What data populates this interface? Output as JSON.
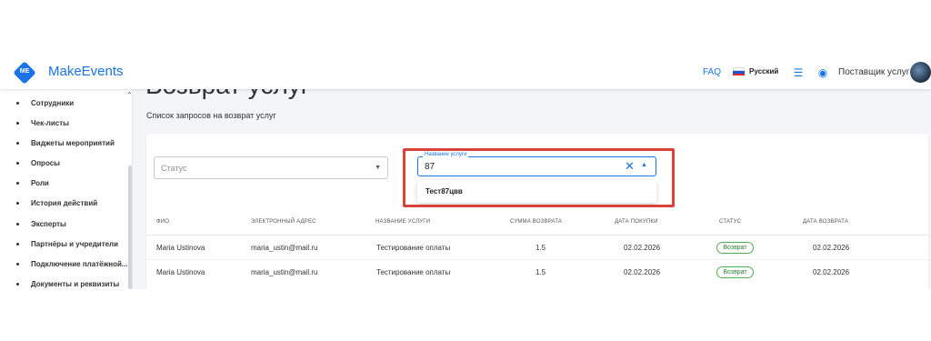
{
  "app": {
    "logo_text": "ME",
    "brand": "MakeEvents"
  },
  "topbar": {
    "faq": "FAQ",
    "language": "Русский",
    "role": "Поставщик услуг",
    "flag_colors": [
      "#ffffff",
      "#1c57d6",
      "#e0262b"
    ]
  },
  "sidebar": {
    "items": [
      {
        "label": "Сотрудники"
      },
      {
        "label": "Чек-листы"
      },
      {
        "label": "Виджеты мероприятий"
      },
      {
        "label": "Опросы"
      },
      {
        "label": "Роли"
      },
      {
        "label": "История действий"
      },
      {
        "label": "Эксперты"
      },
      {
        "label": "Партнёры и учредители"
      },
      {
        "label": "Подключение платёжной..."
      },
      {
        "label": "Документы и реквизиты"
      }
    ]
  },
  "page": {
    "title": "Возврат услуг",
    "subtitle": "Список запросов на возврат услуг"
  },
  "filters": {
    "status_placeholder": "Статус",
    "service_label": "Название услуги",
    "service_value": "87",
    "suggestion": "Тест87цвв"
  },
  "table": {
    "columns": [
      "ФИО",
      "ЭЛЕКТРОННЫЙ АДРЕС",
      "НАЗВАНИЕ УСЛУГИ",
      "СУММА ВОЗВРАТА",
      "ДАТА ПОКУПКИ",
      "СТАТУС",
      "ДАТА ВОЗВРАТА"
    ],
    "rows": [
      {
        "name": "Maria Ustinova",
        "email": "maria_ustin@mail.ru",
        "service": "Тестирование оплаты",
        "amount": "1.5",
        "purchase_date": "02.02.2026",
        "status": "Возврат",
        "refund_date": "02.02.2026"
      },
      {
        "name": "Maria Ustinova",
        "email": "maria_ustin@mail.ru",
        "service": "Тестирование оплаты",
        "amount": "1.5",
        "purchase_date": "02.02.2026",
        "status": "Возврат",
        "refund_date": "02.02.2026"
      }
    ]
  },
  "colors": {
    "accent": "#1a73e8",
    "highlight": "#d9433a",
    "status_green": "#4caf50"
  }
}
